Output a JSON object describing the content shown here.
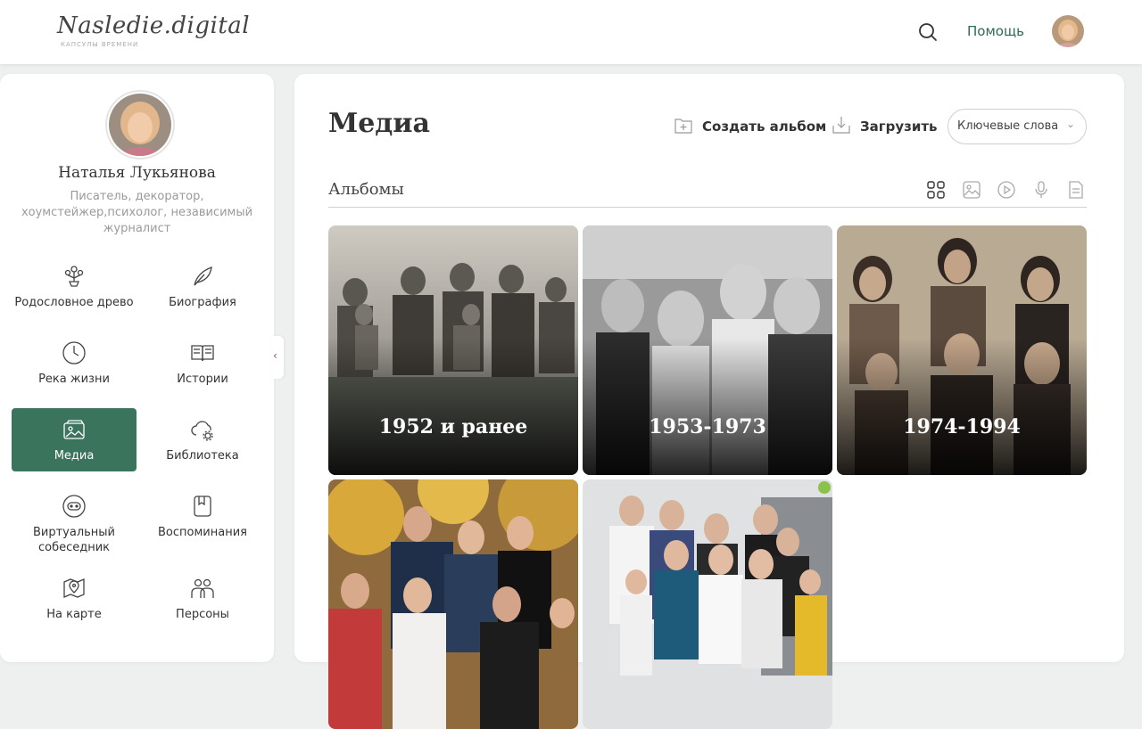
{
  "header": {
    "logo_main": "Nasledie.digital",
    "logo_sub": "КАПСУЛЫ ВРЕМЕНИ",
    "search_icon": "search-icon",
    "help_label": "Помощь"
  },
  "profile": {
    "name": "Наталья Лукьянова",
    "description": "Писатель, декоратор, хоумстейжер,психолог, независимый журналист"
  },
  "sidebar": {
    "items": [
      {
        "label": "Родословное древо",
        "icon": "tree-icon"
      },
      {
        "label": "Биография",
        "icon": "feather-icon"
      },
      {
        "label": "Река жизни",
        "icon": "clock-icon"
      },
      {
        "label": "Истории",
        "icon": "book-icon"
      },
      {
        "label": "Медиа",
        "icon": "photo-album-icon",
        "active": true
      },
      {
        "label": "Библиотека",
        "icon": "cloud-gear-icon"
      },
      {
        "label": "Виртуальный собеседник",
        "icon": "chat-bot-icon"
      },
      {
        "label": "Воспоминания",
        "icon": "notebook-icon"
      },
      {
        "label": "На карте",
        "icon": "map-pin-icon"
      },
      {
        "label": "Персоны",
        "icon": "people-icon"
      }
    ]
  },
  "main": {
    "title": "Медиа",
    "create_album_label": "Создать альбом",
    "upload_label": "Загрузить",
    "keywords_label": "Ключевые слова",
    "section_title": "Альбомы",
    "albums": [
      {
        "title": "1952 и ранее"
      },
      {
        "title": "1953-1973"
      },
      {
        "title": "1974-1994"
      },
      {
        "title": ""
      },
      {
        "title": ""
      }
    ]
  },
  "colors": {
    "accent": "#3a745d",
    "help_link": "#2e6b52"
  }
}
